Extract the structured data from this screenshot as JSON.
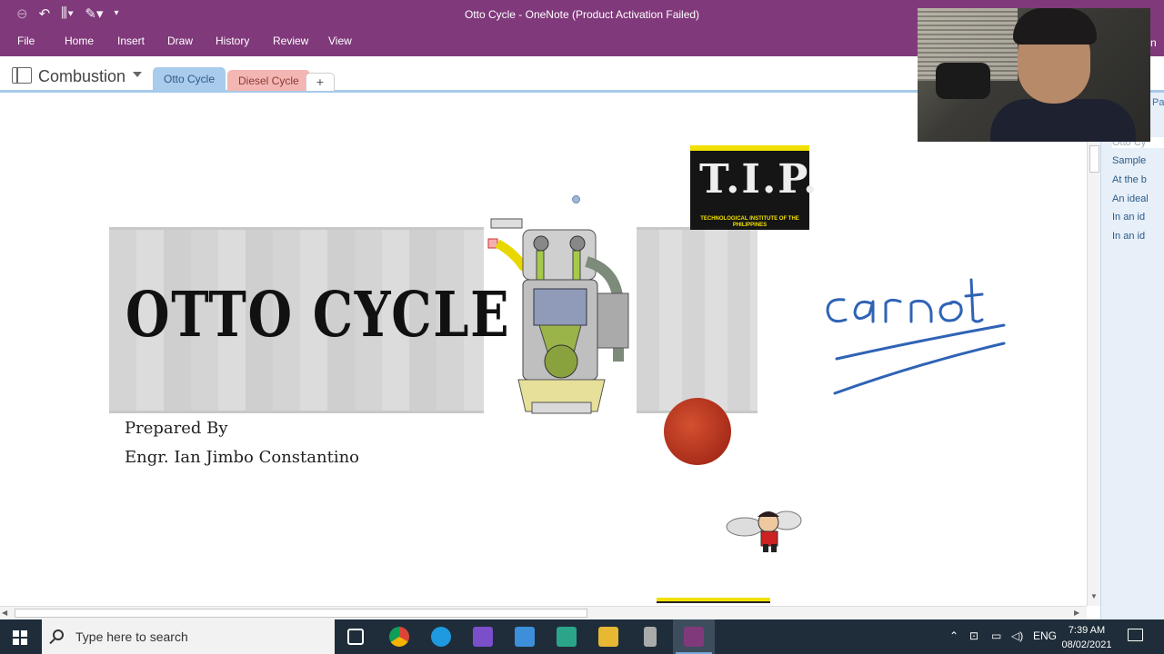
{
  "window": {
    "title": "Otto Cycle - OneNote (Product Activation Failed)",
    "ribbon_tabs": [
      "File",
      "Home",
      "Insert",
      "Draw",
      "History",
      "Review",
      "View"
    ],
    "ribbon_right_fragment": "n"
  },
  "notebook": {
    "name": "Combustion",
    "sections": [
      {
        "label": "Otto Cycle",
        "color": "#a9cbec",
        "active": true
      },
      {
        "label": "Diesel Cycle",
        "color": "#f4b6b3",
        "active": false
      }
    ],
    "add_section": "+"
  },
  "pages_pane": {
    "add_page_fragment": "Pa",
    "items": [
      "Otto Cy",
      "Sample",
      "At the b",
      "An ideal",
      "In an id",
      "In an id"
    ]
  },
  "slide": {
    "title": "OTTO CYCLE",
    "prepared_by": "Prepared By",
    "author": "Engr. Ian Jimbo Constantino",
    "logo_letters": "T.I.P.",
    "logo_subtitle": "TECHNOLOGICAL INSTITUTE OF THE PHILIPPINES"
  },
  "ink": {
    "text": "carnot",
    "color": "#2f63b5"
  },
  "taskbar": {
    "search_placeholder": "Type here to search",
    "language": "ENG",
    "time": "7:39 AM",
    "date": "08/02/2021"
  }
}
